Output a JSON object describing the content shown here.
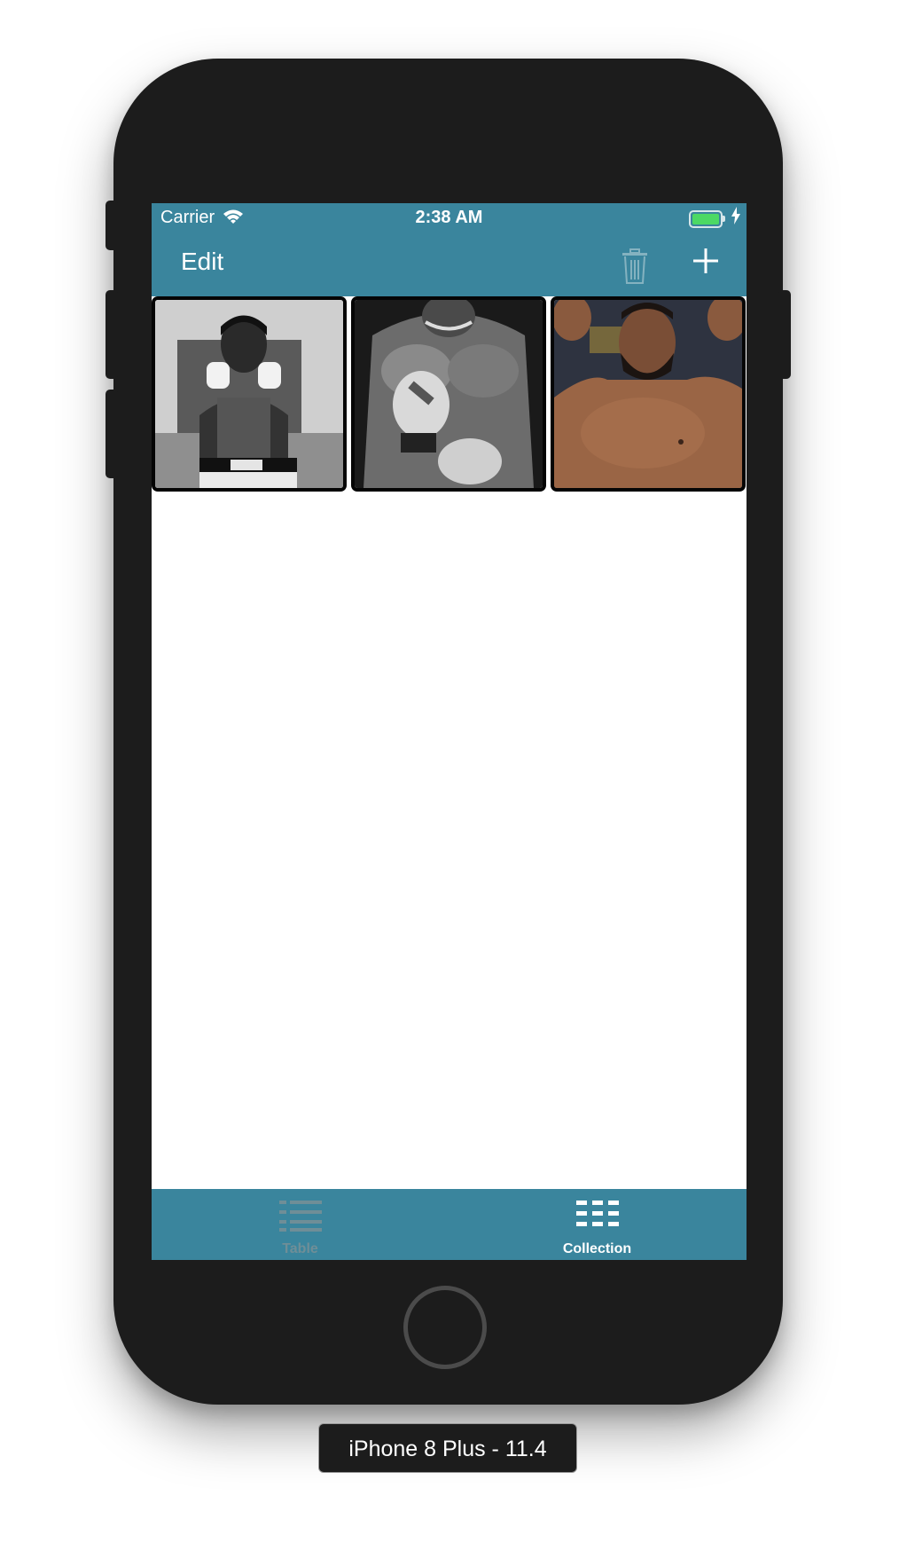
{
  "status_bar": {
    "carrier": "Carrier",
    "time": "2:38 AM"
  },
  "nav_bar": {
    "edit_label": "Edit",
    "trash_icon": "trash-icon",
    "add_icon": "plus-icon"
  },
  "collection": {
    "items": [
      {
        "name": "photo-1",
        "tone": "grayscale"
      },
      {
        "name": "photo-2",
        "tone": "grayscale"
      },
      {
        "name": "photo-3",
        "tone": "color"
      }
    ]
  },
  "tab_bar": {
    "tabs": [
      {
        "label": "Table",
        "icon": "list-icon",
        "selected": false
      },
      {
        "label": "Collection",
        "icon": "grid-icon",
        "selected": true
      }
    ]
  },
  "device_label": "iPhone 8 Plus - 11.4",
  "colors": {
    "accent": "#3a859d",
    "bezel": "#1c1c1c",
    "battery": "#4cd964"
  }
}
